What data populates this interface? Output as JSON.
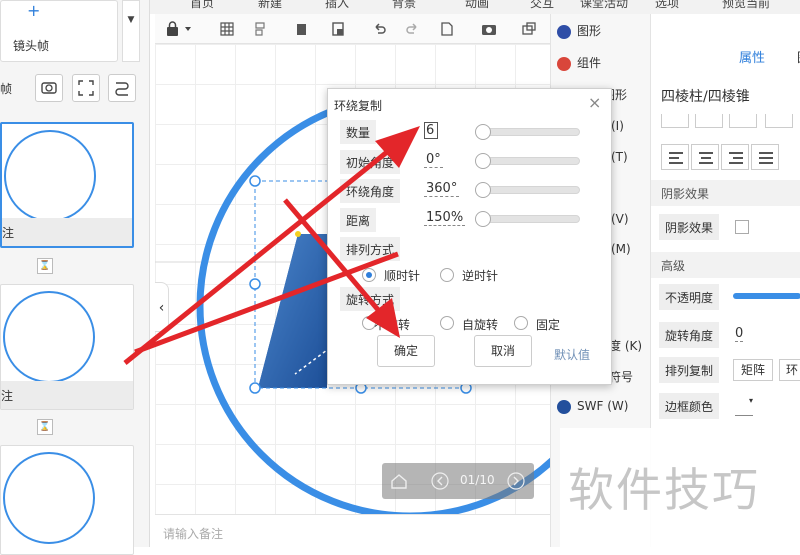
{
  "top_menu": [
    "首页",
    "新建",
    "插入",
    "背景",
    "动画",
    "交互",
    "课堂活动",
    "选项",
    "预览当前"
  ],
  "left_panel": {
    "lens_button_label": "镜头帧",
    "lens_button_plus": "+",
    "caret": "▼",
    "partial_label": "帧",
    "thumbnails": [
      {
        "caption": "注"
      },
      {
        "caption": "注"
      },
      {
        "caption": ""
      }
    ],
    "hourglass": "⌛"
  },
  "canvas": {
    "notes_placeholder": "请输入备注",
    "collapse_glyph": "‹",
    "player": {
      "page": "01/10"
    }
  },
  "side_menu": {
    "items": [
      {
        "label": "图形"
      },
      {
        "label": "组件"
      },
      {
        "label": "形图形"
      },
      {
        "label": "(I)"
      },
      {
        "label": "(T)"
      },
      {
        "label": "(V)"
      },
      {
        "label": "(M)"
      },
      {
        "label": "度 (K)"
      },
      {
        "label": "符号"
      },
      {
        "label": "SWF (W)"
      }
    ]
  },
  "props": {
    "tab_active": "属性",
    "tab_other": "图",
    "shape_name": "四棱柱/四棱锥",
    "shadow_section": "阴影效果",
    "shadow_label": "阴影效果",
    "advanced_section": "高级",
    "opacity_label": "不透明度",
    "rotation_label": "旋转角度",
    "rotation_value": "0",
    "array_copy_label": "排列复制",
    "matrix_btn": "矩阵",
    "ring_btn": "环",
    "border_color_label": "边框颜色"
  },
  "dialog": {
    "title": "环绕复制",
    "close": "×",
    "rows": [
      {
        "label": "数量",
        "value": "6",
        "fraction": 0
      },
      {
        "label": "初始角度",
        "value": "0°",
        "fraction": 0
      },
      {
        "label": "环绕角度",
        "value": "360°",
        "fraction": 0
      },
      {
        "label": "距离",
        "value": "150%",
        "fraction": 0
      }
    ],
    "arrange_label": "排列方式",
    "arrange_options": [
      {
        "label": "顺时针",
        "selected": true
      },
      {
        "label": "逆时针",
        "selected": false
      }
    ],
    "rotate_label": "旋转方式",
    "rotate_options": [
      {
        "label": "不旋转",
        "selected": false
      },
      {
        "label": "自旋转",
        "selected": false
      },
      {
        "label": "固定",
        "selected": false
      }
    ],
    "ok": "确定",
    "cancel": "取消",
    "default": "默认值"
  },
  "watermark": "软件技巧",
  "colors": {
    "accent": "#3a8ee6",
    "arrow": "#e3262a",
    "shape": "#2b63ad"
  }
}
